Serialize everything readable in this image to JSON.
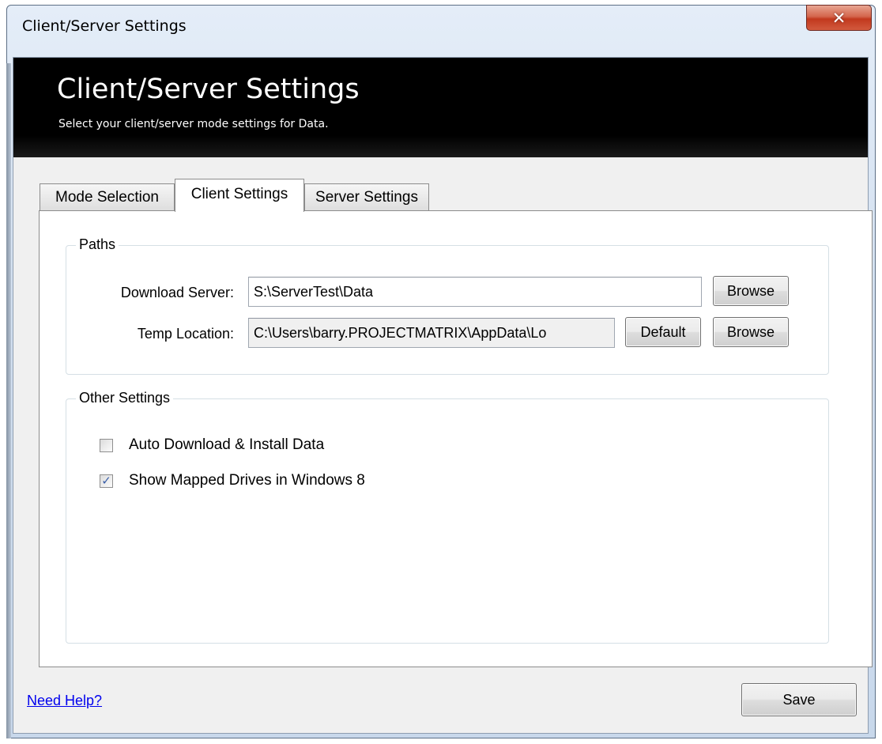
{
  "window": {
    "title": "Client/Server Settings",
    "close_glyph": "✕"
  },
  "banner": {
    "title": "Client/Server Settings",
    "subtitle": "Select your client/server mode settings for Data."
  },
  "tabs": [
    {
      "label": "Mode Selection",
      "active": false
    },
    {
      "label": "Client Settings",
      "active": true
    },
    {
      "label": "Server Settings",
      "active": false
    }
  ],
  "paths_group": {
    "legend": "Paths",
    "download_server": {
      "label": "Download Server:",
      "value": "S:\\ServerTest\\Data",
      "browse_label": "Browse"
    },
    "temp_location": {
      "label": "Temp Location:",
      "value": "C:\\Users\\barry.PROJECTMATRIX\\AppData\\Lo",
      "default_label": "Default",
      "browse_label": "Browse"
    }
  },
  "other_group": {
    "legend": "Other Settings",
    "options": [
      {
        "label": "Auto Download & Install Data",
        "checked": false
      },
      {
        "label": "Show Mapped Drives in Windows 8",
        "checked": true
      }
    ]
  },
  "footer": {
    "help_link": "Need Help?",
    "save_label": "Save"
  },
  "icons": {
    "check": "✓"
  },
  "colors": {
    "banner_bg": "#000000",
    "link": "#0000ee",
    "close_button": "#c2391e"
  }
}
